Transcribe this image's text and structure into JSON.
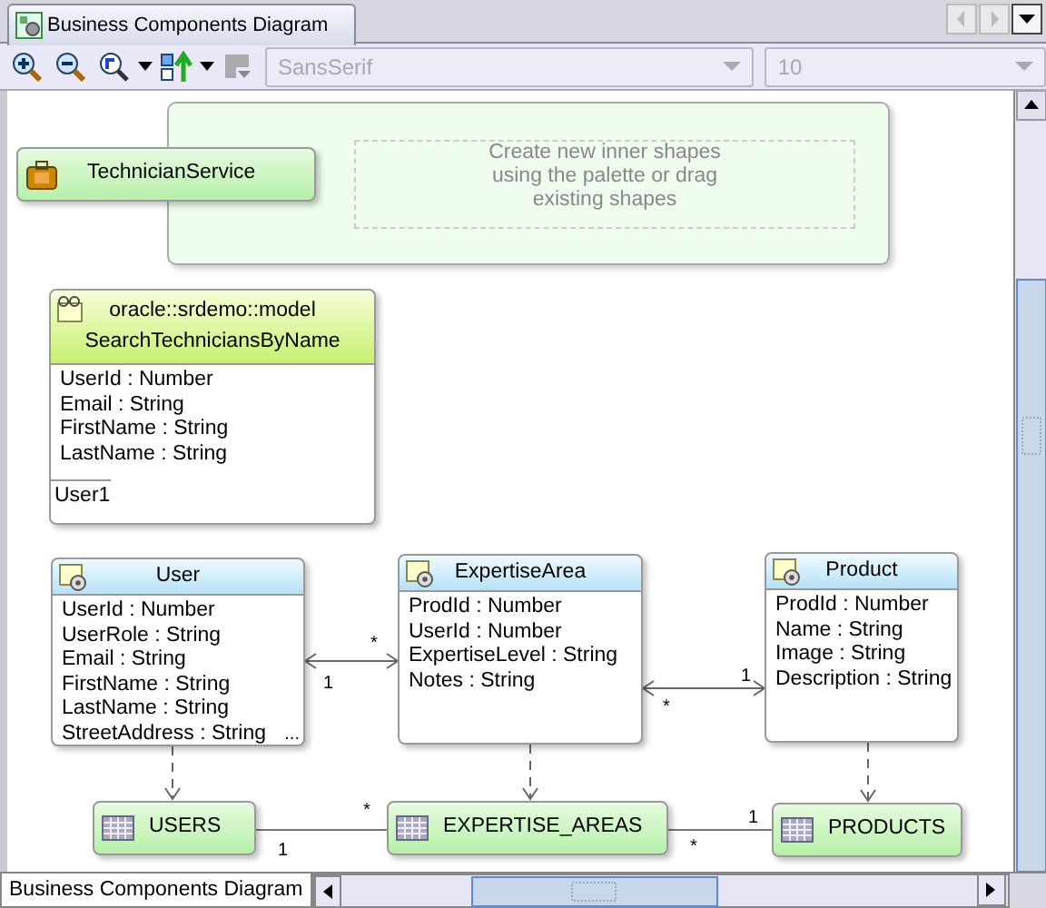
{
  "editor_tab": {
    "title": "Business Components Diagram",
    "selected": true
  },
  "toolbar": {
    "font_field": {
      "value": "SansSerif",
      "disabled": true
    },
    "size_field": {
      "value": "10",
      "disabled": true
    }
  },
  "diagram": {
    "container": {
      "hint": "Create new inner shapes using the palette or drag existing shapes"
    },
    "nodes": [
      {
        "kind": "service",
        "name": "TechnicianService"
      },
      {
        "kind": "view_object",
        "package": "oracle::srdemo::model",
        "name": "SearchTechniciansByName",
        "attributes": [
          "UserId : Number",
          "Email : String",
          "FirstName : String",
          "LastName : String"
        ],
        "footer": "User1"
      },
      {
        "kind": "entity",
        "name": "User",
        "attributes": [
          "UserId : Number",
          "UserRole : String",
          "Email : String",
          "FirstName : String",
          "LastName : String",
          "StreetAddress : String"
        ],
        "more": "..."
      },
      {
        "kind": "entity",
        "name": "ExpertiseArea",
        "attributes": [
          "ProdId : Number",
          "UserId : Number",
          "ExpertiseLevel : String",
          "Notes : String"
        ]
      },
      {
        "kind": "entity",
        "name": "Product",
        "attributes": [
          "ProdId : Number",
          "Name : String",
          "Image : String",
          "Description : String"
        ]
      },
      {
        "kind": "table",
        "name": "USERS"
      },
      {
        "kind": "table",
        "name": "EXPERTISE_AREAS"
      },
      {
        "kind": "table",
        "name": "PRODUCTS"
      }
    ],
    "edges": [
      {
        "kind": "association",
        "labels": [
          "*",
          "1"
        ]
      },
      {
        "kind": "association",
        "labels": [
          "*",
          "1"
        ]
      },
      {
        "kind": "dependency"
      },
      {
        "kind": "dependency"
      },
      {
        "kind": "dependency"
      },
      {
        "kind": "link",
        "labels": [
          "*",
          "1"
        ]
      },
      {
        "kind": "link",
        "labels": [
          "1",
          "*"
        ]
      }
    ]
  },
  "bottom_tab": {
    "title": "Business Components Diagram"
  }
}
